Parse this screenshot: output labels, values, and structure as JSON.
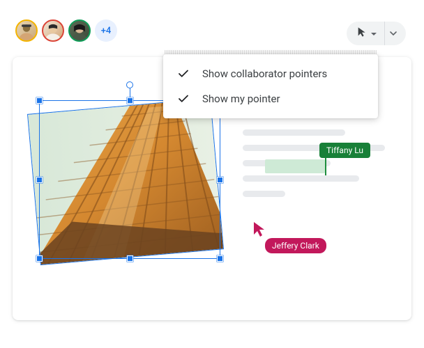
{
  "avatars": {
    "overflow_label": "+4"
  },
  "pointer_menu": {
    "items": [
      {
        "label": "Show collaborator pointers",
        "checked": true
      },
      {
        "label": "Show my pointer",
        "checked": true
      }
    ]
  },
  "collaborators": {
    "tiffany": {
      "name": "Tiffany Lu",
      "color": "#188038"
    },
    "jeffery": {
      "name": "Jeffery Clark",
      "color": "#c2185b"
    }
  },
  "icons": {
    "cursor": "cursor-icon",
    "caret_down": "caret-down-icon",
    "chevron_down": "chevron-down-icon",
    "check": "check-icon"
  }
}
